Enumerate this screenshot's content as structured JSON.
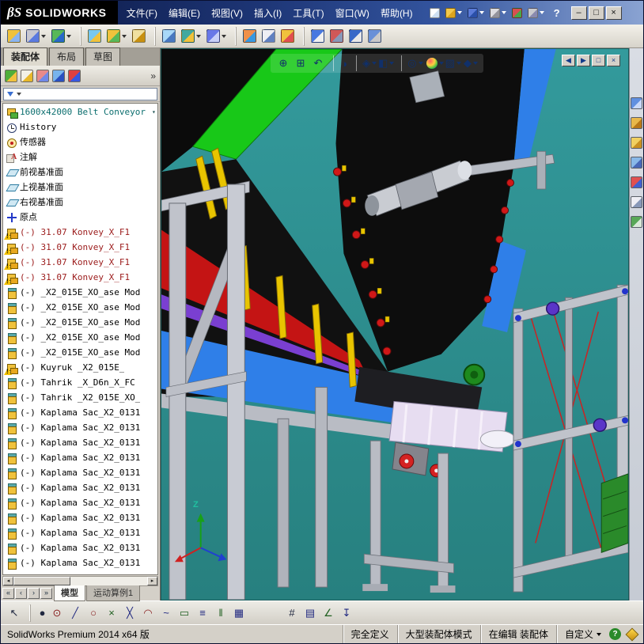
{
  "titlebar": {
    "logo_mark": "βS",
    "logo_text": "SOLIDWORKS",
    "menus": [
      {
        "label": "文件(F)"
      },
      {
        "label": "编辑(E)"
      },
      {
        "label": "视图(V)"
      },
      {
        "label": "插入(I)"
      },
      {
        "label": "工具(T)"
      },
      {
        "label": "窗口(W)"
      },
      {
        "label": "帮助(H)"
      }
    ],
    "quick_icons": [
      {
        "name": "new-document-button",
        "c1": "#ffffff",
        "c2": "#cfe0f2",
        "caret": ""
      },
      {
        "name": "open-button",
        "c1": "#f2c84b",
        "c2": "#dca41e",
        "caret": "caret-on"
      },
      {
        "name": "save-button",
        "c1": "#5a7ad8",
        "c2": "#2a4fa8",
        "caret": "caret-on"
      },
      {
        "name": "print-button",
        "c1": "#dcdce0",
        "c2": "#93939c",
        "caret": "caret-on"
      },
      {
        "name": "rebuild-button",
        "c1": "#d85050",
        "c2": "#48a848",
        "caret": ""
      },
      {
        "name": "options-button",
        "c1": "#cacace",
        "c2": "#8a8aae",
        "caret": "caret-on"
      }
    ],
    "help_label": "?",
    "window_buttons": [
      {
        "name": "minimize-button",
        "glyph": "–"
      },
      {
        "name": "maximize-button",
        "glyph": "□"
      },
      {
        "name": "close-button",
        "glyph": "×"
      }
    ]
  },
  "toolbar": {
    "icons": [
      {
        "name": "insert-component-button",
        "c1": "#f0c23c",
        "c2": "#8ab4f0",
        "cls": "",
        "caret": ""
      },
      {
        "name": "mate-button",
        "c1": "#c8c8d0",
        "c2": "#5a7ae0",
        "cls": "",
        "caret": "caret-on"
      },
      {
        "name": "linear-component-pattern-button",
        "c1": "#58b858",
        "c2": "#2868c8",
        "cls": "",
        "caret": "caret-on"
      },
      {
        "name": "smart-fasteners-button",
        "c1": "#78c8f0",
        "c2": "#f0c23c",
        "cls": "sep",
        "caret": ""
      },
      {
        "name": "move-component-button",
        "c1": "#f0c23c",
        "c2": "#58b858",
        "cls": "",
        "caret": "caret-on"
      },
      {
        "name": "rotate-component-button",
        "c1": "#f0e0a0",
        "c2": "#c89010",
        "cls": "",
        "caret": ""
      },
      {
        "name": "show-hidden-components-button",
        "c1": "#a8d8f8",
        "c2": "#4878c0",
        "cls": "sep",
        "caret": ""
      },
      {
        "name": "assembly-features-button",
        "c1": "#40a8a0",
        "c2": "#f0c23c",
        "cls": "",
        "caret": "caret-on"
      },
      {
        "name": "reference-geometry-button",
        "c1": "#6878e8",
        "c2": "#c8d0f8",
        "cls": "",
        "caret": "caret-on"
      },
      {
        "name": "new-motion-study-button",
        "c1": "#f09048",
        "c2": "#3898e0",
        "cls": "sep",
        "caret": ""
      },
      {
        "name": "bill-of-materials-button",
        "c1": "#eeeef4",
        "c2": "#6080c0",
        "cls": "",
        "caret": ""
      },
      {
        "name": "exploded-view-button",
        "c1": "#f0c23c",
        "c2": "#e05050",
        "cls": "",
        "caret": ""
      },
      {
        "name": "explode-line-sketch-button",
        "c1": "#4878e0",
        "c2": "#f0f0f0",
        "cls": "sep",
        "caret": ""
      },
      {
        "name": "interference-detection-button",
        "c1": "#d05858",
        "c2": "#8898b8",
        "cls": "",
        "caret": ""
      },
      {
        "name": "measure-button",
        "c1": "#3868c8",
        "c2": "#e8e8e8",
        "cls": "",
        "caret": ""
      },
      {
        "name": "mass-properties-button",
        "c1": "#6890d8",
        "c2": "#c8c8c8",
        "cls": "",
        "caret": ""
      }
    ]
  },
  "command_tabs": {
    "items": [
      {
        "label": "装配体",
        "state": "active"
      },
      {
        "label": "布局",
        "state": ""
      },
      {
        "label": "草图",
        "state": ""
      }
    ]
  },
  "feature_panel": {
    "manager_tabs": [
      {
        "name": "featuremanager-tree-tab",
        "c1": "#4fae3a",
        "c2": "#f0c23c"
      },
      {
        "name": "propertymanager-tab",
        "c1": "#f2f0e6",
        "c2": "#e8b82a"
      },
      {
        "name": "configurationmanager-tab",
        "c1": "#e88a8a",
        "c2": "#7088e8"
      },
      {
        "name": "dimxpertmanager-tab",
        "c1": "#78b4ec",
        "c2": "#2a50c0"
      },
      {
        "name": "displaymanager-tab",
        "c1": "#e04040",
        "c2": "#3858e0"
      }
    ],
    "overflow_glyph": "»",
    "filter_caret": "▾",
    "tree": {
      "items": [
        {
          "icon": "ic-top",
          "cls": "flyout",
          "style": "teal",
          "label": "1600x42000 Belt Conveyor"
        },
        {
          "icon": "ic-hist",
          "cls": "",
          "style": "",
          "label": "History"
        },
        {
          "icon": "ic-sensor",
          "cls": "",
          "style": "",
          "label": "传感器"
        },
        {
          "icon": "ic-ann",
          "cls": "",
          "style": "",
          "label": "注解"
        },
        {
          "icon": "ic-plane",
          "cls": "",
          "style": "",
          "label": "前视基准面"
        },
        {
          "icon": "ic-plane",
          "cls": "",
          "style": "",
          "label": "上视基准面"
        },
        {
          "icon": "ic-plane",
          "cls": "",
          "style": "",
          "label": "右视基准面"
        },
        {
          "icon": "ic-origin",
          "cls": "",
          "style": "",
          "label": "原点"
        },
        {
          "icon": "ic-asm",
          "cls": "warn",
          "style": "red",
          "label": "(-) 31.07 Konvey_X_F1"
        },
        {
          "icon": "ic-asm",
          "cls": "warn",
          "style": "red",
          "label": "(-) 31.07 Konvey_X_F1"
        },
        {
          "icon": "ic-asm",
          "cls": "warn",
          "style": "red",
          "label": "(-) 31.07 Konvey_X_F1"
        },
        {
          "icon": "ic-asm",
          "cls": "warn",
          "style": "red",
          "label": "(-) 31.07 Konvey_X_F1"
        },
        {
          "icon": "ic-part",
          "cls": "",
          "style": "",
          "label": "(-) _X2_015E_XO_ase Mod"
        },
        {
          "icon": "ic-part",
          "cls": "",
          "style": "",
          "label": "(-) _X2_015E_XO_ase Mod"
        },
        {
          "icon": "ic-part",
          "cls": "",
          "style": "",
          "label": "(-) _X2_015E_XO_ase Mod"
        },
        {
          "icon": "ic-part",
          "cls": "",
          "style": "",
          "label": "(-) _X2_015E_XO_ase Mod"
        },
        {
          "icon": "ic-part",
          "cls": "",
          "style": "",
          "label": "(-) _X2_015E_XO_ase Mod"
        },
        {
          "icon": "ic-asm",
          "cls": "warn",
          "style": "",
          "label": "(-) Kuyruk _X2_015E_"
        },
        {
          "icon": "ic-part",
          "cls": "",
          "style": "",
          "label": "(-) Tahrik _X_D6n_X_FC"
        },
        {
          "icon": "ic-part",
          "cls": "",
          "style": "",
          "label": "(-) Tahrik _X2_015E_XO_"
        },
        {
          "icon": "ic-part",
          "cls": "",
          "style": "",
          "label": "(-) Kaplama Sac_X2_0131"
        },
        {
          "icon": "ic-part",
          "cls": "",
          "style": "",
          "label": "(-) Kaplama Sac_X2_0131"
        },
        {
          "icon": "ic-part",
          "cls": "",
          "style": "",
          "label": "(-) Kaplama Sac_X2_0131"
        },
        {
          "icon": "ic-part",
          "cls": "",
          "style": "",
          "label": "(-) Kaplama Sac_X2_0131"
        },
        {
          "icon": "ic-part",
          "cls": "",
          "style": "",
          "label": "(-) Kaplama Sac_X2_0131"
        },
        {
          "icon": "ic-part",
          "cls": "",
          "style": "",
          "label": "(-) Kaplama Sac_X2_0131"
        },
        {
          "icon": "ic-part",
          "cls": "",
          "style": "",
          "label": "(-) Kaplama Sac_X2_0131"
        },
        {
          "icon": "ic-part",
          "cls": "",
          "style": "",
          "label": "(-) Kaplama Sac_X2_0131"
        },
        {
          "icon": "ic-part",
          "cls": "",
          "style": "",
          "label": "(-) Kaplama Sac_X2_0131"
        },
        {
          "icon": "ic-part",
          "cls": "",
          "style": "",
          "label": "(-) Kaplama Sac_X2_0131"
        },
        {
          "icon": "ic-part",
          "cls": "",
          "style": "",
          "label": "(-) Kaplama Sac_X2_0131"
        }
      ]
    },
    "bottom_nav": [
      {
        "name": "tab-scroll-first-button",
        "glyph": "«"
      },
      {
        "name": "tab-scroll-prev-button",
        "glyph": "‹"
      },
      {
        "name": "tab-scroll-next-button",
        "glyph": "›"
      },
      {
        "name": "tab-scroll-last-button",
        "glyph": "»"
      }
    ],
    "bottom_tabs": [
      {
        "label": "模型",
        "state": "active"
      },
      {
        "label": "运动算例1",
        "state": ""
      }
    ]
  },
  "viewport": {
    "headsup": [
      {
        "name": "zoom-fit-button",
        "glyph": "⊕",
        "cls": "",
        "caret": ""
      },
      {
        "name": "zoom-area-button",
        "glyph": "⊞",
        "cls": "",
        "caret": ""
      },
      {
        "name": "previous-view-button",
        "glyph": "↶",
        "cls": "",
        "caret": ""
      },
      {
        "name": "section-view-button",
        "glyph": "◑",
        "cls": "sep",
        "caret": ""
      },
      {
        "name": "view-orientation-button",
        "glyph": "◈",
        "cls": "sep",
        "caret": "caret-on"
      },
      {
        "name": "display-style-button",
        "glyph": "◧",
        "cls": "",
        "caret": "caret-on"
      },
      {
        "name": "hide-show-items-button",
        "glyph": "◎",
        "cls": "sep",
        "caret": "caret-on"
      },
      {
        "name": "edit-appearance-button",
        "glyph": "",
        "cls": "sphere-btn",
        "caret": "caret-on"
      },
      {
        "name": "apply-scene-button",
        "glyph": "▨",
        "cls": "",
        "caret": "caret-on"
      },
      {
        "name": "view-settings-button",
        "glyph": "◆",
        "cls": "",
        "caret": "caret-on"
      }
    ],
    "window_buttons": [
      {
        "name": "previous-window-button",
        "glyph": "◀"
      },
      {
        "name": "next-window-button",
        "glyph": "▶"
      },
      {
        "name": "restore-window-button",
        "glyph": "□"
      },
      {
        "name": "close-window-button",
        "glyph": "×"
      }
    ],
    "triad": {
      "z_label": "Z"
    }
  },
  "task_pane": {
    "icons": [
      {
        "name": "solidworks-resources-tab",
        "c1": "#6090e0",
        "c2": "#c8d8f8"
      },
      {
        "name": "design-library-tab",
        "c1": "#e8b84a",
        "c2": "#b87818"
      },
      {
        "name": "file-explorer-tab",
        "c1": "#f0d060",
        "c2": "#c89020"
      },
      {
        "name": "view-palette-tab",
        "c1": "#88b8e8",
        "c2": "#4868b8"
      },
      {
        "name": "appearances-scenes-tab",
        "c1": "#e05050",
        "c2": "#4060d0"
      },
      {
        "name": "custom-properties-tab",
        "c1": "#eeeef4",
        "c2": "#8898b8"
      },
      {
        "name": "forum-tab",
        "c1": "#58a858",
        "c2": "#d8e8d8"
      }
    ]
  },
  "sketch_toolbar": {
    "icons": [
      {
        "name": "select-tool",
        "glyph": "↖",
        "c": "#202840",
        "cls": ""
      },
      {
        "name": "point-tool",
        "glyph": "●",
        "c": "#202840",
        "cls": "sep"
      },
      {
        "name": "circle-tool",
        "glyph": "⊙",
        "c": "#8a2020",
        "cls": ""
      },
      {
        "name": "line-tool",
        "glyph": "╱",
        "c": "#202880",
        "cls": ""
      },
      {
        "name": "ellipse-tool",
        "glyph": "○",
        "c": "#8a2020",
        "cls": ""
      },
      {
        "name": "trim-tool",
        "glyph": "×",
        "c": "#206020",
        "cls": ""
      },
      {
        "name": "dynamic-mirror-tool",
        "glyph": "╳",
        "c": "#202880",
        "cls": ""
      },
      {
        "name": "arc-tool",
        "glyph": "◠",
        "c": "#8a2020",
        "cls": ""
      },
      {
        "name": "spline-tool",
        "glyph": "~",
        "c": "#202880",
        "cls": ""
      },
      {
        "name": "rectangle-tool",
        "glyph": "▭",
        "c": "#206020",
        "cls": ""
      },
      {
        "name": "offset-tool",
        "glyph": "≡",
        "c": "#202880",
        "cls": ""
      },
      {
        "name": "mirror-tool",
        "glyph": "‖",
        "c": "#206020",
        "cls": ""
      },
      {
        "name": "pattern-tool",
        "glyph": "▦",
        "c": "#202880",
        "cls": ""
      },
      {
        "name": "grid-snap-tool",
        "glyph": "#",
        "c": "#202840",
        "cls": "gap"
      },
      {
        "name": "table-tool",
        "glyph": "▤",
        "c": "#202880",
        "cls": ""
      },
      {
        "name": "angle-snap-tool",
        "glyph": "∠",
        "c": "#206020",
        "cls": ""
      },
      {
        "name": "anchor-tool",
        "glyph": "↧",
        "c": "#202880",
        "cls": ""
      }
    ]
  },
  "statusbar": {
    "product": "SolidWorks Premium 2014 x64 版",
    "definition": "完全定义",
    "mode": "大型装配体模式",
    "editing": "在编辑 装配体",
    "custom": "自定义",
    "help_glyph": "?"
  },
  "colors": {
    "viewport_bg": "#2e8f8f",
    "belt_black": "#0d0d0d",
    "accent_green": "#18c818",
    "accent_blue": "#2f7fe8",
    "accent_red": "#c41414",
    "accent_purple": "#7a3fd1",
    "frame_gray": "#c0c3cb",
    "warning_yellow": "#f2c200",
    "titlebar_blue": "#1d3575"
  }
}
